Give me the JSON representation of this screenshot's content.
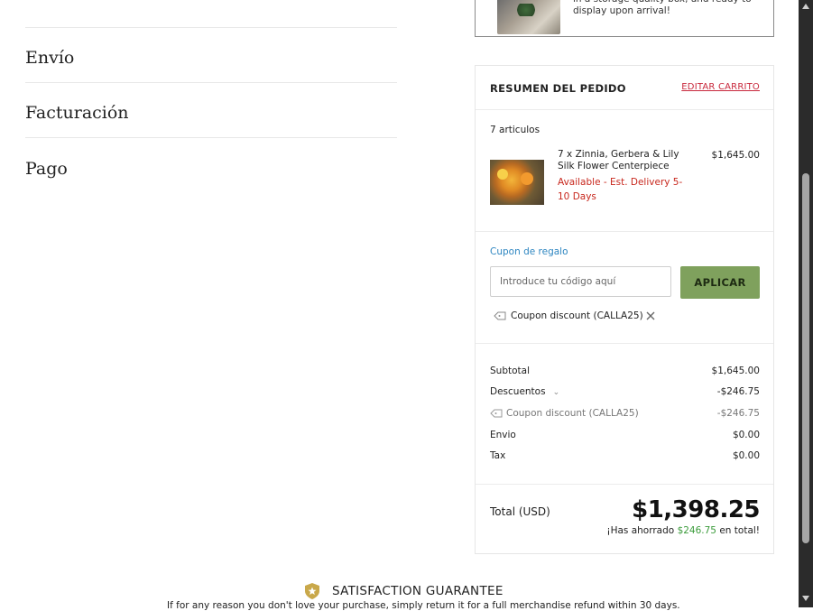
{
  "steps": [
    "Envío",
    "Facturación",
    "Pago"
  ],
  "shipping_note": "in a storage quality box, and ready to display upon arrival!",
  "summary": {
    "title": "RESUMEN DEL PEDIDO",
    "edit_cart": "EDITAR CARRITO",
    "items_count": "7 articulos",
    "item": {
      "name": "7 x Zinnia, Gerbera & Lily Silk Flower Centerpiece",
      "availability": "Available - Est. Delivery 5-10 Days",
      "price": "$1,645.00"
    },
    "coupon": {
      "label": "Cupon de regalo",
      "placeholder": "Introduce tu código aquí",
      "value": "",
      "apply": "APLICAR",
      "applied": "Coupon discount (CALLA25)"
    },
    "totals": {
      "subtotal_label": "Subtotal",
      "subtotal": "$1,645.00",
      "discounts_label": "Descuentos",
      "discounts": "-$246.75",
      "coupon_label": "Coupon discount (CALLA25)",
      "coupon": "-$246.75",
      "shipping_label": "Envio",
      "shipping": "$0.00",
      "tax_label": "Tax",
      "tax": "$0.00",
      "total_label": "Total (USD)",
      "total": "$1,398.25",
      "saved_prefix": "¡Has ahorrado",
      "saved_amount": "$246.75",
      "saved_suffix": "en total!"
    }
  },
  "guarantee": {
    "title": "SATISFACTION GUARANTEE",
    "text": "If for any reason you don't love your purchase, simply return it for a full merchandise refund within 30 days."
  },
  "icons": {
    "tag": "tag-icon",
    "remove": "close-icon",
    "chevron": "chevron-down-icon",
    "guarantee": "shield-star-icon"
  },
  "colors": {
    "accent_green": "#7fa15d",
    "link_red": "#c8283c",
    "link_blue": "#2e86c1",
    "availability_red": "#c8281e",
    "saved_green": "#3a9b3a",
    "gold": "#c9a84a"
  }
}
